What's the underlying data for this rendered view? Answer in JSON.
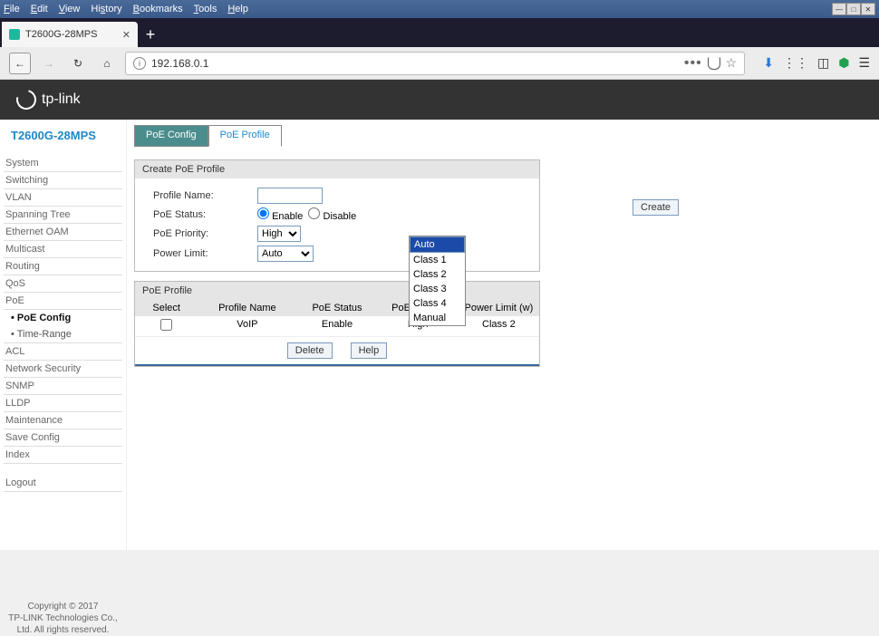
{
  "menubar": {
    "items": [
      "File",
      "Edit",
      "View",
      "History",
      "Bookmarks",
      "Tools",
      "Help"
    ]
  },
  "tab": {
    "title": "T2600G-28MPS"
  },
  "url": "192.168.0.1",
  "brand": "tp-link",
  "model": "T2600G-28MPS",
  "sidebar": {
    "items": [
      "System",
      "Switching",
      "VLAN",
      "Spanning Tree",
      "Ethernet OAM",
      "Multicast",
      "Routing",
      "QoS",
      "PoE"
    ],
    "subs": [
      "• PoE Config",
      "• Time-Range"
    ],
    "items2": [
      "ACL",
      "Network Security",
      "SNMP",
      "LLDP",
      "Maintenance",
      "Save Config",
      "Index"
    ],
    "logout": "Logout"
  },
  "copyright": {
    "l1": "Copyright © 2017",
    "l2": "TP-LINK Technologies Co.,",
    "l3": "Ltd. All rights reserved."
  },
  "tabs": {
    "config": "PoE Config",
    "profile": "PoE Profile"
  },
  "panel1": {
    "title": "Create PoE Profile",
    "labels": {
      "name": "Profile Name:",
      "status": "PoE Status:",
      "priority": "PoE Priority:",
      "limit": "Power Limit:"
    },
    "enable": "Enable",
    "disable": "Disable",
    "priority_val": "High",
    "limit_val": "Auto",
    "create": "Create"
  },
  "dropdown": {
    "options": [
      "Auto",
      "Class 1",
      "Class 2",
      "Class 3",
      "Class 4",
      "Manual"
    ],
    "selected": "Auto"
  },
  "panel2": {
    "title": "PoE Profile",
    "cols": {
      "select": "Select",
      "name": "Profile Name",
      "status": "PoE Status",
      "priority": "PoE Priority",
      "limit": "Power Limit (w)"
    },
    "row": {
      "name": "VoIP",
      "status": "Enable",
      "priority": "High",
      "limit": "Class 2"
    },
    "buttons": {
      "delete": "Delete",
      "help": "Help"
    }
  }
}
